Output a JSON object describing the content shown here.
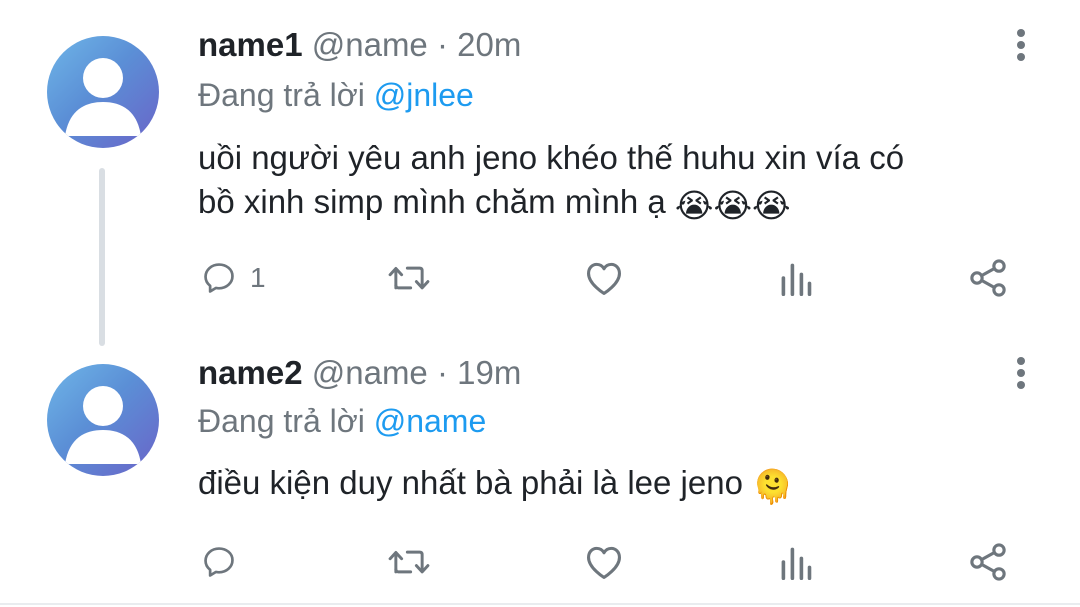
{
  "tweets": [
    {
      "name": "name1",
      "handle": "@name",
      "separator": "·",
      "time": "20m",
      "reply_prefix": "Đang trả lời",
      "reply_to": "@jnlee",
      "text_line1": "uồi người yêu anh jeno khéo thế huhu xin vía có",
      "text_line2": "bồ xinh simp mình chăm mình ạ",
      "emoji": "😭😭😭",
      "reply_count": "1",
      "icons": [
        "reply-icon",
        "retweet-icon",
        "like-icon",
        "views-icon",
        "share-icon",
        "more-icon"
      ]
    },
    {
      "name": "name2",
      "handle": "@name",
      "separator": "·",
      "time": "19m",
      "reply_prefix": "Đang trả lời",
      "reply_to": "@name",
      "text_line1": "điều kiện duy nhất bà phải là lee jeno",
      "emoji": "🫠",
      "reply_count": "",
      "icons": [
        "reply-icon",
        "retweet-icon",
        "like-icon",
        "views-icon",
        "share-icon",
        "more-icon"
      ]
    }
  ],
  "colors": {
    "text": "#1f2328",
    "secondary": "#6e767d",
    "mention": "#1d9bf0",
    "thread_line": "#d9dee3"
  }
}
